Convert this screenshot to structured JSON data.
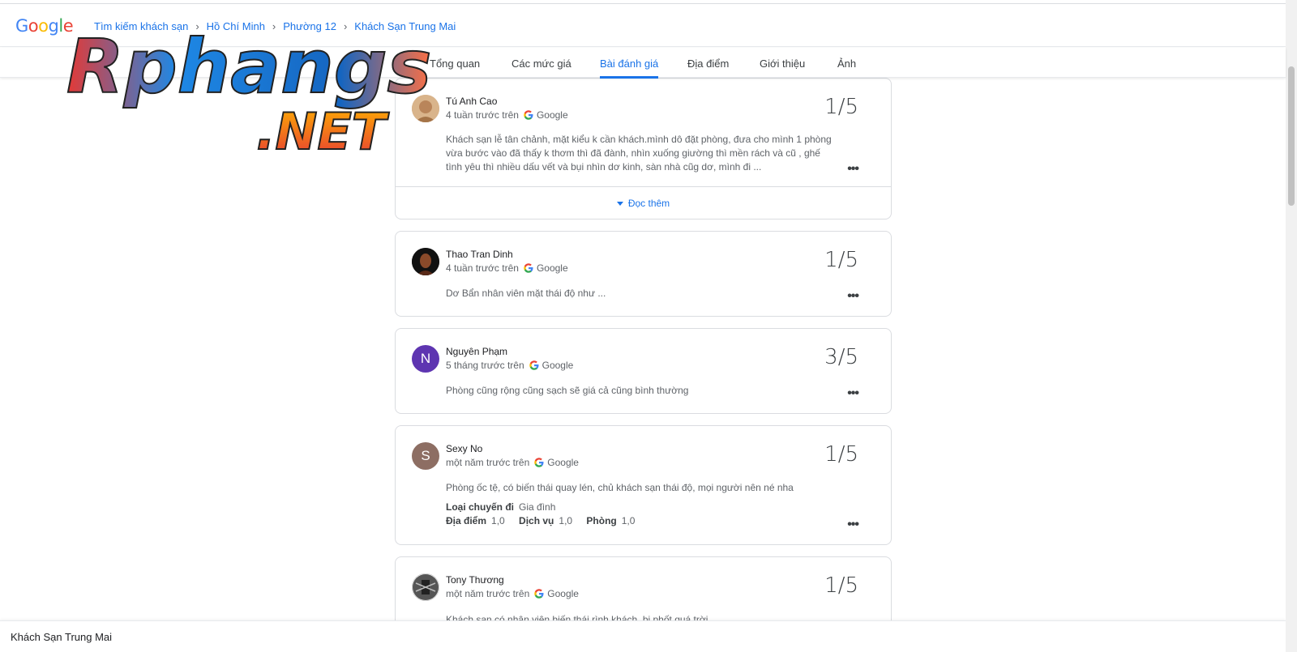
{
  "logo": {
    "text": "Google"
  },
  "breadcrumbs": [
    "Tìm kiếm khách sạn",
    "Hồ Chí Minh",
    "Phường 12",
    "Khách Sạn Trung Mai"
  ],
  "tabs": [
    {
      "label": "Tổng quan",
      "active": false
    },
    {
      "label": "Các mức giá",
      "active": false
    },
    {
      "label": "Bài đánh giá",
      "active": true
    },
    {
      "label": "Địa điểm",
      "active": false
    },
    {
      "label": "Giới thiệu",
      "active": false
    },
    {
      "label": "Ảnh",
      "active": false
    }
  ],
  "source_label": "Google",
  "read_more_label": "Đọc thêm",
  "more_label": "•••",
  "reviews": [
    {
      "name": "Tú Anh Cao",
      "time": "4 tuần trước trên",
      "score": "1/5",
      "text": "Khách sạn lễ tân chảnh, mặt kiểu k cần khách.mình dô đặt phòng, đưa cho mình 1 phòng vừa bước vào đã thấy k thơm thì đã đành, nhìn xuống giường thì mền rách và cũ , ghế tình yêu thì nhiều dấu vết và bụi nhìn dơ kinh, sàn nhà cũg dơ, mình đi ..."
    },
    {
      "name": "Thao Tran Dinh",
      "time": "4 tuần trước trên",
      "score": "1/5",
      "text": "Dơ Bẩn nhân viên mặt thái độ như ..."
    },
    {
      "name": "Nguyên Phạm",
      "time": "5 tháng trước trên",
      "score": "3/5",
      "initial": "N",
      "avatar_color": "#5e35b1",
      "text": "Phòng cũng rộng cũng sạch sẽ giá cả cũng bình thường"
    },
    {
      "name": "Sexy No",
      "time": "một năm trước trên",
      "score": "1/5",
      "initial": "S",
      "avatar_color": "#8d6e63",
      "text": "Phòng ốc tệ, có biến thái quay lén, chủ khách sạn thái độ, mọi người nên né nha",
      "trip_type_label": "Loại chuyến đi",
      "trip_type_value": "Gia đình",
      "ratings": [
        {
          "label": "Địa điểm",
          "value": "1,0"
        },
        {
          "label": "Dịch vụ",
          "value": "1,0"
        },
        {
          "label": "Phòng",
          "value": "1,0"
        }
      ]
    },
    {
      "name": "Tony Thương",
      "time": "một năm trước trên",
      "score": "1/5",
      "text": "Khách sạn có nhân viên biến thái rình khách, bị phốt quá trời"
    }
  ],
  "footer": {
    "title": "Khách Sạn Trung Mai"
  },
  "watermark": {
    "line1": "Rphangs",
    "line2": ".NET"
  }
}
